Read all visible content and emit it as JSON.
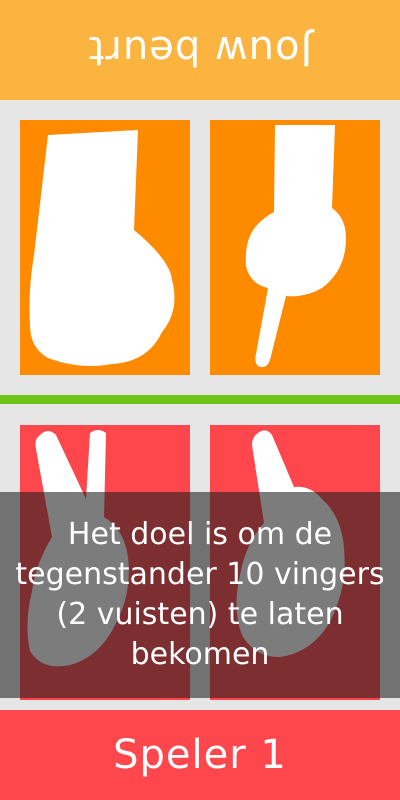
{
  "colors": {
    "opponent_accent": "#fbb440",
    "opponent_card": "#fe8a00",
    "player_card": "#fe474c",
    "divider": "#6fc517",
    "background": "#e6e6e6"
  },
  "opponent": {
    "banner_label": "Jouw beurt",
    "hands": [
      {
        "name": "fist-icon",
        "fingers": 0
      },
      {
        "name": "one-finger-icon",
        "fingers": 1
      }
    ]
  },
  "player": {
    "banner_label": "Speler 1",
    "hands": [
      {
        "name": "two-fingers-icon",
        "fingers": 2
      },
      {
        "name": "one-finger-icon",
        "fingers": 1
      }
    ]
  },
  "overlay": {
    "message": "Het doel is om de tegenstander 10 vingers (2 vuisten) te laten bekomen"
  }
}
